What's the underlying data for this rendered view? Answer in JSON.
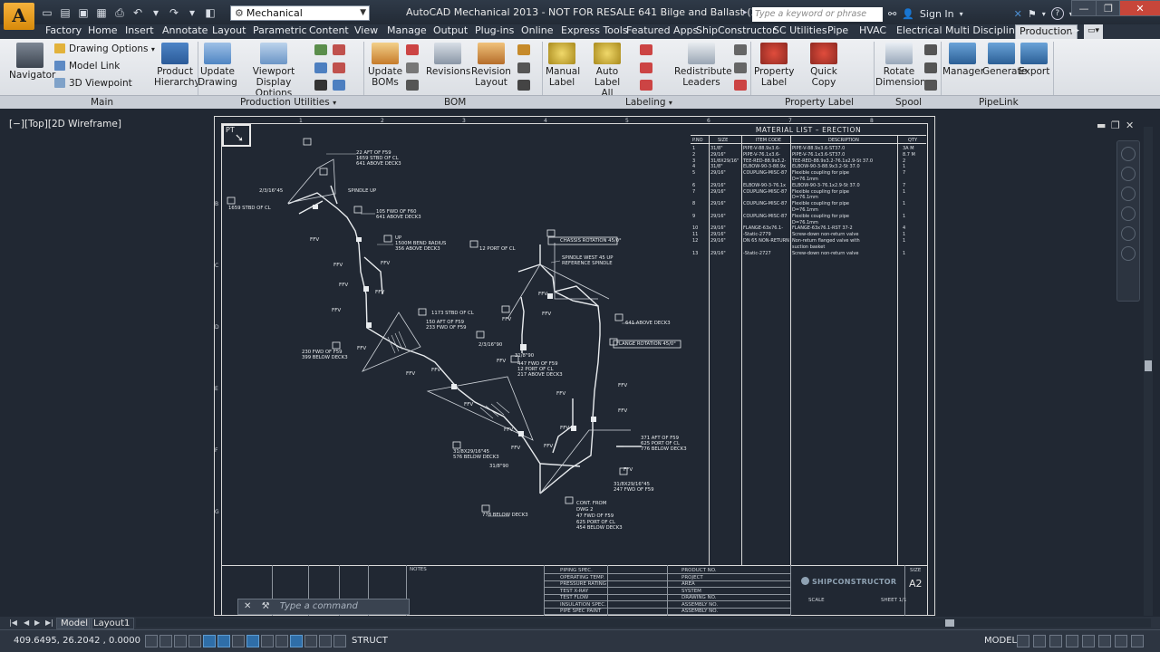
{
  "app": {
    "logo": "A",
    "title": "AutoCAD Mechanical 2013 - NOT FOR RESALE     641 Bilge and Ballast (2)B.DXF",
    "workspace": "Mechanical",
    "search_placeholder": "Type a keyword or phrase",
    "sign_in": "Sign In"
  },
  "tabs": [
    "Factory",
    "Home",
    "Insert",
    "Annotate",
    "Layout",
    "Parametric",
    "Content",
    "View",
    "Manage",
    "Output",
    "Plug-ins",
    "Online",
    "Express Tools",
    "Featured Apps",
    "ShipConstructor",
    "SC Utilities",
    "Pipe",
    "HVAC",
    "Electrical",
    "Multi Discipline",
    "Production"
  ],
  "active_tab": "Production",
  "ribbon": {
    "navigator": "Navigator",
    "drawing_options": "Drawing Options",
    "model_link": "Model Link",
    "viewpoint_3d": "3D Viewpoint",
    "product_hierarchy": [
      "Product",
      "Hierarchy"
    ],
    "update_drawing": [
      "Update",
      "Drawing"
    ],
    "viewport_display": [
      "Viewport",
      "Display Options"
    ],
    "update_boms": [
      "Update",
      "BOMs"
    ],
    "revisions": "Revisions",
    "revision_layout": [
      "Revision",
      "Layout"
    ],
    "manual_label": [
      "Manual",
      "Label"
    ],
    "auto_label_all": [
      "Auto Label",
      "All"
    ],
    "redistribute_leaders": [
      "Redistribute",
      "Leaders"
    ],
    "property_label": [
      "Property",
      "Label"
    ],
    "quick_copy": "Quick Copy",
    "rotate_dimension": [
      "Rotate",
      "Dimension"
    ],
    "manager": "Manager",
    "generate": "Generate",
    "export": "Export"
  },
  "panels": [
    "Main",
    "Production Utilities",
    "BOM",
    "Labeling",
    "Property Label",
    "Spool",
    "PipeLink"
  ],
  "viewport": {
    "label": "[−][Top][2D Wireframe]"
  },
  "drawing": {
    "pt_label": "PT",
    "material_list_title": "MATERIAL LIST – ERECTION",
    "material_list_headers": [
      "P.NO",
      "SIZE",
      "ITEM CODE",
      "DESCRIPTION",
      "QTY"
    ],
    "material_rows": [
      [
        "1",
        "31/8\"",
        "PIPE-V-88.9x3.6-",
        "PIPE-V-88.9x3.6-ST37.0",
        "3A M"
      ],
      [
        "2",
        "29/16\"",
        "PIPE-V-76.1x3.6-",
        "PIPE-V-76.1x3.6-ST37.0",
        "8.7 M"
      ],
      [
        "3",
        "31/8X29/16\"",
        "TEE-RED-88.9x3.2-",
        "TEE-RED-88.9x3.2-76.1x2.9-St 37.0",
        "2"
      ],
      [
        "4",
        "31/8\"",
        "ELBOW-90-3-88.9x",
        "ELBOW-90-3-88.9x3.2-St 37.0",
        "1"
      ],
      [
        "5",
        "29/16\"",
        "COUPLING-MISC-87",
        "Flexible coupling for pipe",
        "7"
      ],
      [
        "",
        "",
        "",
        "D=76.1mm",
        ""
      ],
      [
        "6",
        "29/16\"",
        "ELBOW-90-3-76.1x",
        "ELBOW-90-3-76.1x2.9-St 37.0",
        "7"
      ],
      [
        "7",
        "29/16\"",
        "COUPLING-MISC-87",
        "Flexible coupling for pipe",
        "1"
      ],
      [
        "",
        "",
        "",
        "D=76.1mm",
        ""
      ],
      [
        "8",
        "29/16\"",
        "COUPLING-MISC-87",
        "Flexible coupling for pipe",
        "1"
      ],
      [
        "",
        "",
        "",
        "D=76.1mm",
        ""
      ],
      [
        "9",
        "29/16\"",
        "COUPLING-MISC-87",
        "Flexible coupling for pipe",
        "1"
      ],
      [
        "",
        "",
        "",
        "D=76.1mm",
        ""
      ],
      [
        "10",
        "29/16\"",
        "FLANGE-63x76.1-",
        "FLANGE-63x76.1-RST 37-2",
        "4"
      ],
      [
        "11",
        "29/16\"",
        "-Static-2779",
        "Screw-down non-return valve",
        "1"
      ],
      [
        "12",
        "29/16\"",
        "DN 65 NON-RETURN",
        "Non-return flanged valve with",
        "1"
      ],
      [
        "",
        "",
        "",
        "suction basket",
        ""
      ],
      [
        "13",
        "29/16\"",
        "-Static-2727",
        "Screw-down non-return valve",
        "1"
      ]
    ],
    "annotations": [
      "22 AFT OF F59",
      "1659 STBD OF CL",
      "641 ABOVE DECK3",
      "2/3/16\"45",
      "SPINDLE UP",
      "1659 STBD OF CL",
      "105 FWD OF F60",
      "641 ABOVE DECK3",
      "UP",
      "1500M BEND RADIUS",
      "356 ABOVE DECK3",
      "12 PORT OF CL",
      "CHASSIS ROTATION 45/0°",
      "SPINDLE WEST 45 UP",
      "REFERENCE SPINDLE",
      "1173 STBD OF CL",
      "150 AFT OF F59",
      "233 FWD OF F59",
      "230 FWD OF F59",
      "399 BELOW DECK3",
      "447 FWD OF F59",
      "12 PORT OF CL",
      "217 ABOVE DECK3",
      "641 ABOVE DECK3",
      "FLANGE ROTATION 45/0°",
      "371 AFT OF F59",
      "625 PORT OF CL",
      "776 BELOW DECK3",
      "31/8X29/16\"45",
      "576 BELOW DECK3",
      "31/8\"90",
      "31/8X29/16\"45",
      "247 FWD OF F59",
      "CONT. FROM",
      "DWG 2",
      "47 FWD OF F59",
      "625 PORT OF CL",
      "454 BELOW DECK3",
      "778 BELOW DECK3",
      "2/3/16\"90",
      "31/8\"90"
    ],
    "ffv": "FFV",
    "titleblock": {
      "notes": "NOTES",
      "fields_left": [
        "PIPING SPEC.",
        "OPERATING TEMP.",
        "PRESSURE RATING",
        "TEST X-RAY",
        "TEST FLOW",
        "INSULATION SPEC.",
        "PIPE SPEC PAINT"
      ],
      "fields_right": [
        "PRODUCT NO.",
        "PROJECT",
        "AREA",
        "SYSTEM",
        "DRAWING NO.",
        "ASSEMBLY NO.",
        "ASSEMBLY NO."
      ],
      "brand": "SHIPCONSTRUCTOR",
      "size_label": "SIZE",
      "size_value": "A2",
      "scale_label": "SCALE",
      "sheet_label": "SHEET 1/1"
    }
  },
  "command": {
    "placeholder": "Type a command"
  },
  "layout_tabs": [
    "Model",
    "Layout1"
  ],
  "active_layout": "Model",
  "status": {
    "coords": "409.6495, 26.2042 , 0.0000",
    "struct": "STRUCT",
    "model": "MODEL"
  },
  "colors": {
    "canvas": "#212833",
    "lines": "#e9ecef",
    "ribbon": "#e4e7eb",
    "active_tab": "#dcdfe4"
  }
}
